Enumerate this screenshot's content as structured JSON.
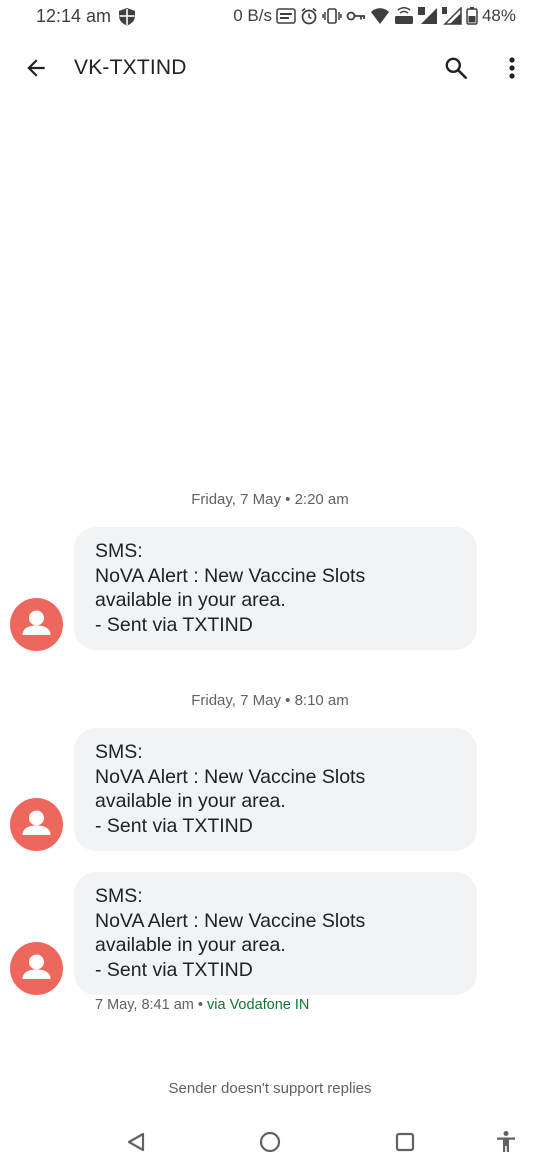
{
  "status_bar": {
    "time": "12:14 am",
    "net_speed": "0 B/s",
    "battery": "48%"
  },
  "app_bar": {
    "title": "VK-TXTIND"
  },
  "conversation": {
    "groups": [
      {
        "date": "Friday, 7 May",
        "time": "2:20 am",
        "messages": [
          {
            "lines": [
              "SMS:",
              "NoVA Alert : New Vaccine Slots",
              "available in your area.",
              "- Sent via TXTIND"
            ]
          }
        ]
      },
      {
        "date": "Friday, 7 May",
        "time": "8:10 am",
        "messages": [
          {
            "lines": [
              "SMS:",
              "NoVA Alert : New Vaccine Slots",
              "available in your area.",
              "- Sent via TXTIND"
            ]
          },
          {
            "lines": [
              "SMS:",
              "NoVA Alert : New Vaccine Slots",
              "available in your area.",
              "- Sent via TXTIND"
            ]
          }
        ]
      }
    ],
    "last_meta": {
      "timestamp": "7 May, 8:41 am",
      "separator": "•",
      "carrier": "via Vodafone IN"
    }
  },
  "footer_note": "Sender doesn't support replies",
  "colors": {
    "avatar": "#ee675c",
    "bubble": "#f1f3f4",
    "carrier_text": "#137333"
  },
  "icons": [
    "shield-icon",
    "back-arrow-icon",
    "search-icon",
    "more-vert-icon",
    "person-icon",
    "nav-back-icon",
    "nav-home-icon",
    "nav-recents-icon",
    "accessibility-icon"
  ]
}
